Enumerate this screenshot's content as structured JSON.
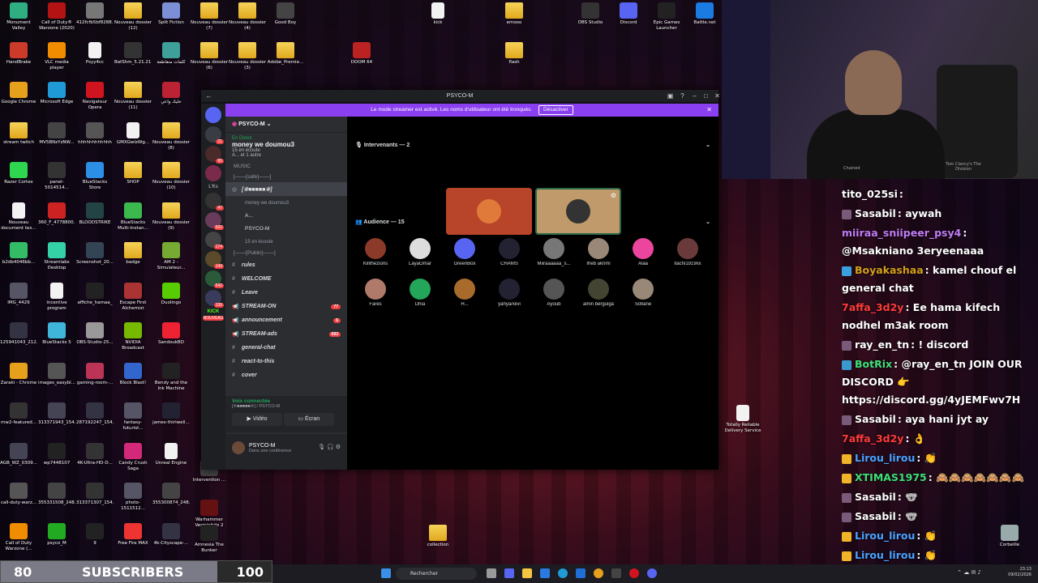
{
  "desktop": {
    "icons": [
      {
        "label": "Monument Valley",
        "color": "#2fae82"
      },
      {
        "label": "Call of Duty® Warzone (2020)",
        "color": "#b31313"
      },
      {
        "label": "412fcfb5bf8288...",
        "color": "#777"
      },
      {
        "label": "Nouveau dossier (12)",
        "color": "folder"
      },
      {
        "label": "Split Fiction",
        "color": "#7c8fd6"
      },
      {
        "label": "Nouveau dossier (7)",
        "color": "folder"
      },
      {
        "label": "Nouveau dossier (4)",
        "color": "folder"
      },
      {
        "label": "Good Boy",
        "color": "#444"
      },
      {
        "label": "HandBrake",
        "color": "#cc3b2a"
      },
      {
        "label": "VLC media player",
        "color": "#f08c00"
      },
      {
        "label": "Psyy4cc",
        "color": "file"
      },
      {
        "label": "BatShm_5.21.21...",
        "color": "#333"
      },
      {
        "label": "كلمات متقاطعة",
        "color": "#3fa09a"
      },
      {
        "label": "Nouveau dossier (6)",
        "color": "folder"
      },
      {
        "label": "Nouveau dossier (3)",
        "color": "folder"
      },
      {
        "label": "Adobe_Premie...",
        "color": "folder"
      },
      {
        "label": "Google Chrome",
        "color": "#e6a11c"
      },
      {
        "label": "Microsoft Edge",
        "color": "#1f9ad6"
      },
      {
        "label": "Navigateur Opera",
        "color": "#d0141f"
      },
      {
        "label": "Nouveau dossier (11)",
        "color": "folder"
      },
      {
        "label": "خليك واعي",
        "color": "#b23"
      },
      {
        "label": "stream twitch",
        "color": "folder"
      },
      {
        "label": "MV5BNzYzNW...",
        "color": "#444"
      },
      {
        "label": "hhhhhhhhhhhh",
        "color": "#555"
      },
      {
        "label": "GMXGwIzWg...",
        "color": "file"
      },
      {
        "label": "Nouveau dossier (8)",
        "color": "folder"
      },
      {
        "label": "Razer Cortex",
        "color": "#2fd64f"
      },
      {
        "label": "panel-5014514...",
        "color": "#333"
      },
      {
        "label": "BlueStacks Store",
        "color": "#2d8ee6"
      },
      {
        "label": "SHOP",
        "color": "folder"
      },
      {
        "label": "Nouveau dossier (10)",
        "color": "folder"
      },
      {
        "label": "Nouveau document tex...",
        "color": "file"
      },
      {
        "label": "360_F_4778800...",
        "color": "#c22"
      },
      {
        "label": "BLOODSTRIKE",
        "color": "#244"
      },
      {
        "label": "BlueStacks Multi-Instan...",
        "color": "#3bb84e"
      },
      {
        "label": "Nouveau dossier (9)",
        "color": "folder"
      },
      {
        "label": "b2db4046bb...",
        "color": "#3b6"
      },
      {
        "label": "Streamlabs Desktop",
        "color": "#34d1a6"
      },
      {
        "label": "Screenshot_20...",
        "color": "#345"
      },
      {
        "label": "badge",
        "color": "folder"
      },
      {
        "label": "AM 2 - Simulateur...",
        "color": "#7a3"
      },
      {
        "label": "IMG_4429",
        "color": "#556"
      },
      {
        "label": "incentive program",
        "color": "file"
      },
      {
        "label": "affiche_hamaa_",
        "color": "#222"
      },
      {
        "label": "Escape First Alchemist",
        "color": "#a33"
      },
      {
        "label": "Duolingo",
        "color": "#58cc02"
      },
      {
        "label": "125941043_212...",
        "color": "#334"
      },
      {
        "label": "BlueStacks 5",
        "color": "#3fb6d9"
      },
      {
        "label": "OBS-Studio-25...",
        "color": "#999"
      },
      {
        "label": "NVIDIA Broadcast",
        "color": "#76b900"
      },
      {
        "label": "SandoukBD",
        "color": "#e23"
      },
      {
        "label": "Zaraki - Chrome",
        "color": "#e6a11c"
      },
      {
        "label": "images_easybl...",
        "color": "#555"
      },
      {
        "label": "gaming-room-...",
        "color": "#b35"
      },
      {
        "label": "Block Blast!",
        "color": "#36c"
      },
      {
        "label": "Bendy and the Ink Machine",
        "color": "#222"
      },
      {
        "label": "mw2-featured...",
        "color": "#333"
      },
      {
        "label": "313371943_154...",
        "color": "#445"
      },
      {
        "label": "287192247_154...",
        "color": "#334"
      },
      {
        "label": "fantasy-futurist...",
        "color": "#556"
      },
      {
        "label": "james-thirlwell...",
        "color": "#223"
      },
      {
        "label": "AGB_WZ_0309...",
        "color": "#445"
      },
      {
        "label": "wp7448107",
        "color": "#222"
      },
      {
        "label": "4K-Ultra-HD-D...",
        "color": "#333"
      },
      {
        "label": "Candy Crush Saga",
        "color": "#d4297a"
      },
      {
        "label": "Unreal Engine",
        "color": "file"
      },
      {
        "label": "call-duty-warz...",
        "color": "#555"
      },
      {
        "label": "355331508_248...",
        "color": "#444"
      },
      {
        "label": "313371307_154...",
        "color": "#333"
      },
      {
        "label": "photo-1511512...",
        "color": "#556"
      },
      {
        "label": "355300874_248...",
        "color": "#444"
      },
      {
        "label": "Call of Duty Warzone (...",
        "color": "#f08c00"
      },
      {
        "label": "psyco_M",
        "color": "#2a2"
      },
      {
        "label": "9",
        "color": "#222"
      },
      {
        "label": "Free Fire MAX",
        "color": "#e33"
      },
      {
        "label": "4k-Cityscape-...",
        "color": "#334"
      },
      {
        "label": "kick",
        "color": "file"
      },
      {
        "label": "emooo",
        "color": "folder"
      },
      {
        "label": "flash",
        "color": "folder"
      },
      {
        "label": "DOOM 64",
        "color": "#b22"
      },
      {
        "label": "OBS Studio",
        "color": "#333"
      },
      {
        "label": "Discord",
        "color": "#5865f2"
      },
      {
        "label": "Epic Games Launcher",
        "color": "#222"
      },
      {
        "label": "Battle.net",
        "color": "#1a7be0"
      },
      {
        "label": "Intervention ...",
        "color": "#444"
      },
      {
        "label": "Warhammer Vermintide 2",
        "color": "#611"
      },
      {
        "label": "Amnesia The Bunker",
        "color": "#222"
      },
      {
        "label": "Totally Reliable Delivery Service",
        "color": "file"
      },
      {
        "label": "collection",
        "color": "folder"
      },
      {
        "label": "Corbeille",
        "color": "#9aa"
      }
    ]
  },
  "discord": {
    "window_title": "PSYCO-M",
    "banner_text": "Le mode streamer est activé. Les noms d'utilisateur ont été tronqués.",
    "banner_button": "Désactiver",
    "server_name": "PSYCO-M",
    "live_tag": "En Direct",
    "live_title": "money we doumou3",
    "live_sub": "15 en écoute",
    "live_sub2": "A... et 1 autre",
    "music": "MUSIC",
    "cat_safe": "[——{safe}——]",
    "voice_channel": "[※■■■■■※]",
    "voice_sub": "money we doumou3",
    "voice_user1": "A...",
    "voice_user2": "PSYCO-M",
    "voice_user3": "15 en écoute",
    "cat_public": "[——{Public}——]",
    "channels": [
      {
        "name": "rules",
        "type": "#",
        "badge": ""
      },
      {
        "name": "WELCOME",
        "type": "#",
        "badge": ""
      },
      {
        "name": "Leave",
        "type": "#",
        "badge": ""
      },
      {
        "name": "STREAM-ON",
        "type": "◀",
        "badge": "77"
      },
      {
        "name": "announcement",
        "type": "◀",
        "badge": "6"
      },
      {
        "name": "STREAM-ads",
        "type": "◀",
        "badge": "693"
      },
      {
        "name": "general-chat",
        "type": "#",
        "badge": ""
      },
      {
        "name": "react-to-this",
        "type": "#",
        "badge": ""
      },
      {
        "name": "cover",
        "type": "#",
        "badge": ""
      }
    ],
    "voice_connected": "Voix connectée",
    "voice_connected_sub": "[※■■■■■※] / PSYCO-M",
    "video_btn": "Vidéo",
    "screen_btn": "Écran",
    "user_name": "PSYCO-M",
    "user_status": "Dans une conférence",
    "speakers_header": "Intervenants — 2",
    "audience_header": "Audience — 15",
    "audience": [
      {
        "name": "Killthezions",
        "color": "#8b3a2a"
      },
      {
        "name": "LayaOmar",
        "color": "#ddd"
      },
      {
        "name": "GreenBox",
        "color": "#5865f2"
      },
      {
        "name": "CHAMS",
        "color": "#223"
      },
      {
        "name": "Miiraaaaaa_s...",
        "color": "#777"
      },
      {
        "name": "Iheb akrimi",
        "color": "#998877"
      },
      {
        "name": "Alaa",
        "color": "#eb459e"
      },
      {
        "name": "itachi1919xx",
        "color": "#6a3a3a"
      },
      {
        "name": "Fares",
        "color": "#b07a6a"
      },
      {
        "name": "Dhia",
        "color": "#23a55a"
      },
      {
        "name": "H...",
        "color": "#a86b2b"
      },
      {
        "name": "yahya/xiivi",
        "color": "#223"
      },
      {
        "name": "Ayoub",
        "color": "#555"
      },
      {
        "name": "amin berguiga",
        "color": "#443"
      },
      {
        "name": "Sofiane",
        "color": "#987"
      }
    ],
    "guild_labels": [
      "L'Ks",
      "KICK",
      "NOUVEAU"
    ],
    "guild_badges": [
      "21",
      "65",
      "47",
      "692",
      "174",
      "149",
      "642",
      "130"
    ]
  },
  "webcam": {
    "poster_text": "Tom Clancy's The Division",
    "chair_text": "Chained"
  },
  "chat": [
    {
      "user": "tito_025si",
      "text": "",
      "color": "#ffffff",
      "badge": "none"
    },
    {
      "user": "Sasabil",
      "text": "aywah",
      "color": "#ffffff",
      "badge": "user"
    },
    {
      "user": "miiraa_sniipeer_psy4",
      "text": "@Msakniano 3eryeenaaa",
      "color": "#c07cf5",
      "badge": "none"
    },
    {
      "user": "Boyakashaa",
      "text": "kamel chouf el general chat",
      "color": "#d4a017",
      "badge": "gem"
    },
    {
      "user": "7affa_3d2y",
      "text": "Ee hama kifech nodhel m3ak room",
      "color": "#ff3b3b",
      "badge": "none"
    },
    {
      "user": "ray_en_tn",
      "text": "! discord",
      "color": "#ffffff",
      "badge": "user"
    },
    {
      "user": "BotRix",
      "text": "@ray_en_tn JOIN OUR DISCORD 👉 https://discord.gg/4yJEMFwv7H",
      "color": "#3ee07a",
      "badge": "bot"
    },
    {
      "user": "Sasabil",
      "text": "aya hani jyt ay",
      "color": "#ffffff",
      "badge": "user"
    },
    {
      "user": "7affa_3d2y",
      "text": "👌",
      "color": "#ff3b3b",
      "badge": "none"
    },
    {
      "user": "Lirou_lirou",
      "text": "👏",
      "color": "#4aa3ff",
      "badge": "crown"
    },
    {
      "user": "XTIMAS1975",
      "text": "🙈🙈🙈🙈🙈🙈🙈",
      "color": "#3ee07a",
      "badge": "crown"
    },
    {
      "user": "Sasabil",
      "text": "🐨",
      "color": "#ffffff",
      "badge": "user"
    },
    {
      "user": "Sasabil",
      "text": "🐨",
      "color": "#ffffff",
      "badge": "user"
    },
    {
      "user": "Lirou_lirou",
      "text": "👏",
      "color": "#4aa3ff",
      "badge": "crown"
    },
    {
      "user": "Lirou_lirou",
      "text": "👏",
      "color": "#4aa3ff",
      "badge": "crown"
    },
    {
      "user": "Lirou_lirou",
      "text": "👏",
      "color": "#4aa3ff",
      "badge": "crown"
    }
  ],
  "subs": {
    "current": "80",
    "label": "SUBSCRIBERS",
    "goal": "100",
    "progress": 0.8
  },
  "taskbar": {
    "search_placeholder": "Rechercher",
    "time": "23:13",
    "date": "09/02/2026"
  }
}
